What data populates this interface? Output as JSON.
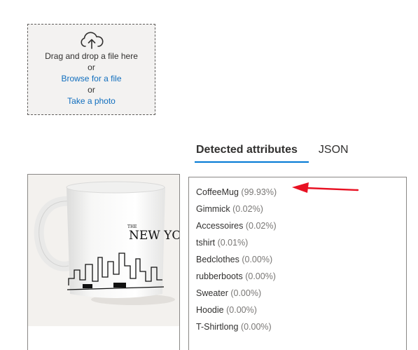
{
  "upload": {
    "drag_text": "Drag and drop a file here",
    "or_1": "or",
    "browse_link": "Browse for a file",
    "or_2": "or",
    "photo_link": "Take a photo"
  },
  "tabs": [
    {
      "label": "Detected attributes",
      "active": true
    },
    {
      "label": "JSON",
      "active": false
    }
  ],
  "image": {
    "wordmark_prefix": "THE",
    "wordmark": "NEW YO"
  },
  "attributes": [
    {
      "name": "CoffeeMug",
      "confidence": "(99.93%)"
    },
    {
      "name": "Gimmick",
      "confidence": "(0.02%)"
    },
    {
      "name": "Accessoires",
      "confidence": "(0.02%)"
    },
    {
      "name": "tshirt",
      "confidence": "(0.01%)"
    },
    {
      "name": "Bedclothes",
      "confidence": "(0.00%)"
    },
    {
      "name": "rubberboots",
      "confidence": "(0.00%)"
    },
    {
      "name": "Sweater",
      "confidence": "(0.00%)"
    },
    {
      "name": "Hoodie",
      "confidence": "(0.00%)"
    },
    {
      "name": "T-Shirtlong",
      "confidence": "(0.00%)"
    }
  ],
  "colors": {
    "accent": "#0078d4",
    "link": "#106ebe",
    "annotation_arrow": "#e81123"
  }
}
